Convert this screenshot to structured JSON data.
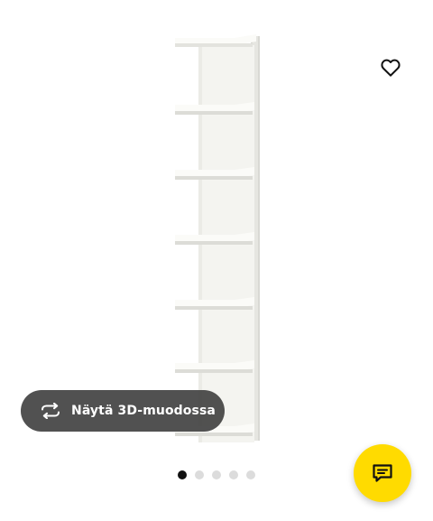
{
  "product": {
    "image": "white-wall-shelf-unit",
    "favourite_icon": "heart-outline-icon"
  },
  "view_3d": {
    "label": "Näytä 3D-muodossa",
    "icon": "rotate-arrows-icon"
  },
  "carousel": {
    "total": 5,
    "active_index": 0
  },
  "chat": {
    "icon": "chat-bubble-icon",
    "color": "#ffdb00"
  },
  "colors": {
    "pill_background": "#424242",
    "dot_active": "#111111",
    "dot_inactive": "#dcdcdc"
  }
}
